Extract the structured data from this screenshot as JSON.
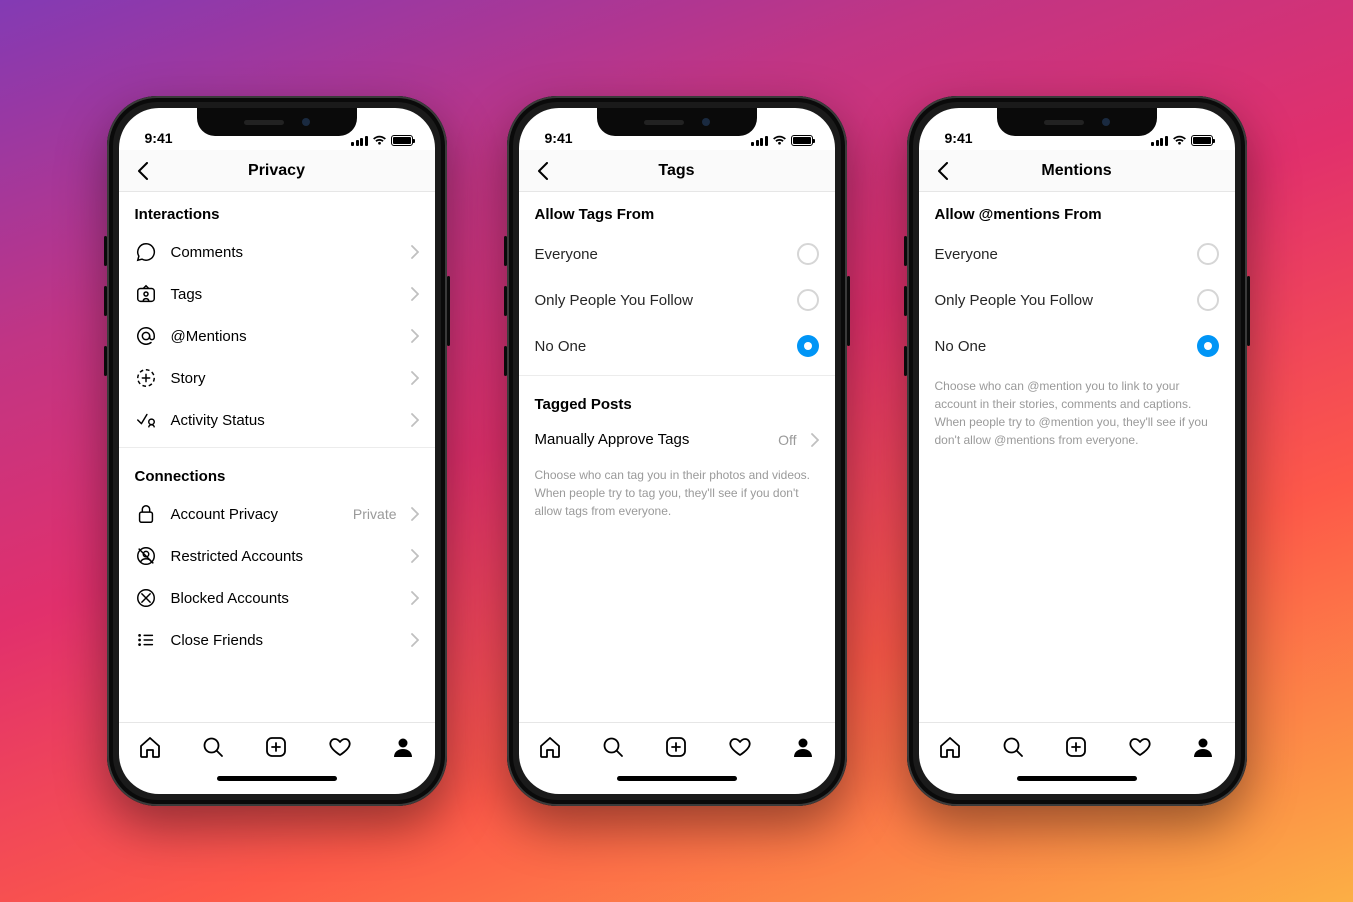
{
  "status": {
    "time": "9:41"
  },
  "phones": {
    "privacy": {
      "title": "Privacy",
      "section1": "Interactions",
      "items1": {
        "comments": "Comments",
        "tags": "Tags",
        "mentions": "@Mentions",
        "story": "Story",
        "activity": "Activity Status"
      },
      "section2": "Connections",
      "items2": {
        "account_privacy": "Account Privacy",
        "account_privacy_value": "Private",
        "restricted": "Restricted Accounts",
        "blocked": "Blocked Accounts",
        "close_friends": "Close Friends"
      }
    },
    "tags": {
      "title": "Tags",
      "section1": "Allow Tags From",
      "opt_everyone": "Everyone",
      "opt_following": "Only People You Follow",
      "opt_noone": "No One",
      "section2": "Tagged Posts",
      "approve_label": "Manually Approve Tags",
      "approve_value": "Off",
      "caption": "Choose who can tag you in their photos and videos. When people try to tag you, they'll see if you don't allow tags from everyone."
    },
    "mentions": {
      "title": "Mentions",
      "section1": "Allow @mentions From",
      "opt_everyone": "Everyone",
      "opt_following": "Only People You Follow",
      "opt_noone": "No One",
      "caption": "Choose who can @mention you to link to your account in their stories, comments and captions. When people try to @mention you, they'll see if you don't allow @mentions from everyone."
    }
  }
}
